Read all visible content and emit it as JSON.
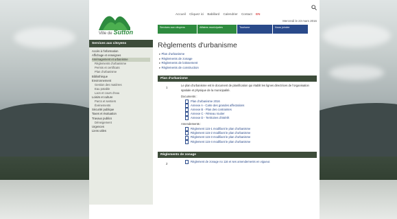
{
  "site": {
    "logo_prefix": "Ville de",
    "logo_name": "Sutton"
  },
  "toplinks": [
    {
      "label": "Accueil"
    },
    {
      "label": "Cliquez ici"
    },
    {
      "label": "Babillard"
    },
    {
      "label": "Calendrier"
    },
    {
      "label": "Contact"
    },
    {
      "label": "EN"
    }
  ],
  "dateline": "Mercredi le 23 mars 2016",
  "mainnav": [
    {
      "label": "Services aux citoyens"
    },
    {
      "label": "Affaires municipales"
    },
    {
      "label": "Tourisme"
    },
    {
      "label": "Nous joindre"
    }
  ],
  "sidebar": {
    "heading": "Services aux citoyens",
    "items": [
      {
        "label": "Accès à l'information",
        "sub": false,
        "hl": false
      },
      {
        "label": "Affichage et enseignes",
        "sub": false,
        "hl": false
      },
      {
        "label": "Aménagement et urbanisme",
        "sub": false,
        "hl": true
      },
      {
        "label": "Règlements d'urbanisme",
        "sub": true,
        "hl": false
      },
      {
        "label": "Permis et certificats",
        "sub": true,
        "hl": false
      },
      {
        "label": "Plan d'urbanisme",
        "sub": true,
        "hl": false
      },
      {
        "label": "Bibliothèque",
        "sub": false,
        "hl": false
      },
      {
        "label": "Environnement",
        "sub": false,
        "hl": false
      },
      {
        "label": "Gestion des matières",
        "sub": true,
        "hl": false
      },
      {
        "label": "Eau potable",
        "sub": true,
        "hl": false
      },
      {
        "label": "Lacs et cours d'eau",
        "sub": true,
        "hl": false
      },
      {
        "label": "Loisirs et culture",
        "sub": false,
        "hl": false
      },
      {
        "label": "Parcs et sentiers",
        "sub": true,
        "hl": false
      },
      {
        "label": "Événements",
        "sub": true,
        "hl": false
      },
      {
        "label": "Sécurité publique",
        "sub": false,
        "hl": false
      },
      {
        "label": "Taxes et évaluation",
        "sub": false,
        "hl": false
      },
      {
        "label": "Travaux publics",
        "sub": false,
        "hl": false
      },
      {
        "label": "Déneigement",
        "sub": true,
        "hl": false
      },
      {
        "label": "Urgences",
        "sub": false,
        "hl": false
      },
      {
        "label": "Liens utiles",
        "sub": false,
        "hl": false
      }
    ]
  },
  "content": {
    "title": "Règlements d'urbanisme",
    "anchors": [
      {
        "label": "Plan d'urbanisme"
      },
      {
        "label": "Règlements de zonage"
      },
      {
        "label": "Règlements de lotissement"
      },
      {
        "label": "Règlements de construction"
      }
    ],
    "section1": {
      "heading": "Plan d'urbanisme",
      "number": "1",
      "paragraph": "Le plan d'urbanisme est le document de planification qui établit les lignes directrices de l'organisation spatiale et physique de la municipalité.",
      "docs_label": "Documents :",
      "docs": [
        {
          "label": "Plan d'urbanisme 2016"
        },
        {
          "label": "Annexe A - Carte des grandes affectations"
        },
        {
          "label": "Annexe B - Plan des contraintes"
        },
        {
          "label": "Annexe C - Réseau routier"
        },
        {
          "label": "Annexe D - Territoires d'intérêt"
        }
      ],
      "docs_label2": "Amendements :",
      "docs2": [
        {
          "label": "Règlement 115-1 modifiant le plan d'urbanisme"
        },
        {
          "label": "Règlement 115-2 modifiant le plan d'urbanisme"
        },
        {
          "label": "Règlement 115-3 modifiant le plan d'urbanisme"
        },
        {
          "label": "Règlement 115-4 modifiant le plan d'urbanisme"
        }
      ]
    },
    "section2": {
      "heading": "Règlements de zonage",
      "number": "2",
      "paragraph": "Règlement de zonage no 116 et ses amendements en vigueur."
    }
  }
}
